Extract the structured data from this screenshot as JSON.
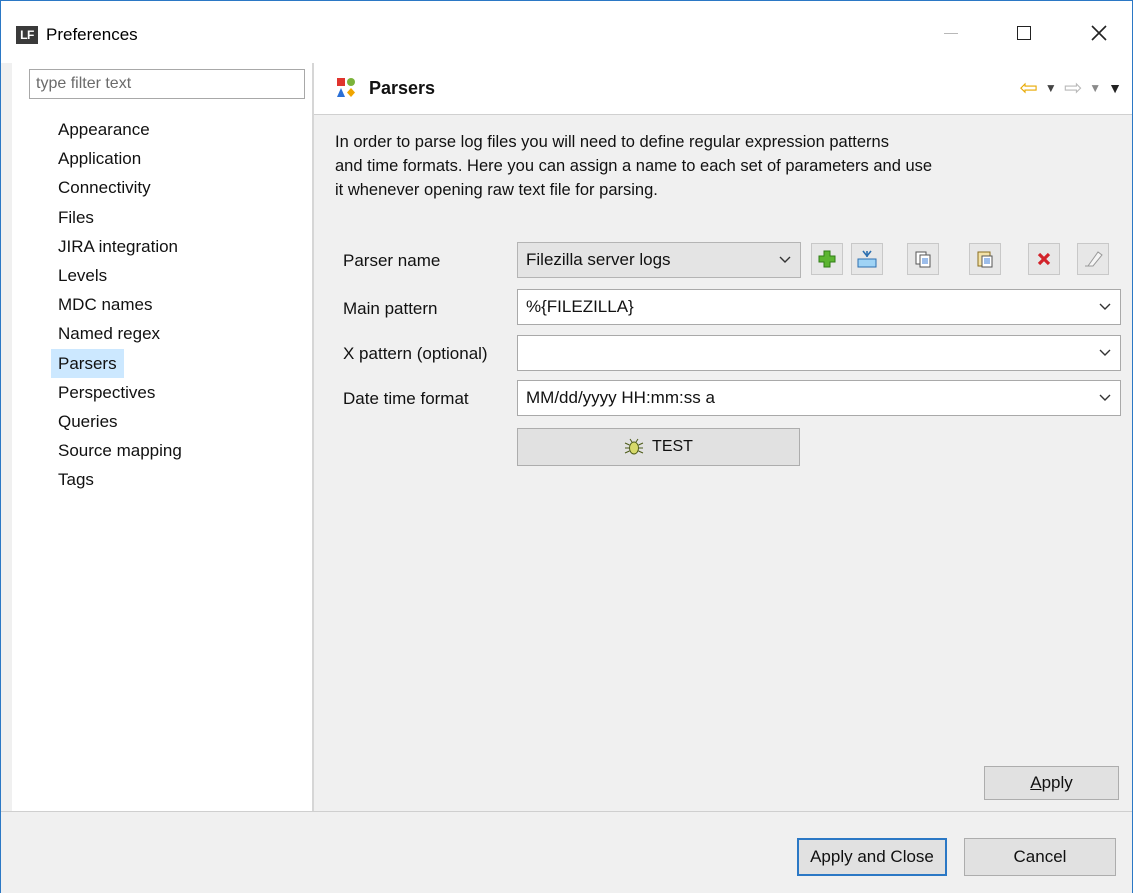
{
  "window": {
    "logo_text": "LF",
    "title": "Preferences"
  },
  "filter": {
    "placeholder": "type filter text"
  },
  "tree": {
    "items": [
      {
        "label": "Appearance"
      },
      {
        "label": "Application"
      },
      {
        "label": "Connectivity"
      },
      {
        "label": "Files"
      },
      {
        "label": "JIRA integration"
      },
      {
        "label": "Levels"
      },
      {
        "label": "MDC names"
      },
      {
        "label": "Named regex"
      },
      {
        "label": "Parsers"
      },
      {
        "label": "Perspectives"
      },
      {
        "label": "Queries"
      },
      {
        "label": "Source mapping"
      },
      {
        "label": "Tags"
      }
    ],
    "selected": "Parsers"
  },
  "page": {
    "title": "Parsers",
    "description_lines": [
      "In order to parse log files you will need to define regular expression patterns",
      "and time formats. Here you can assign a name to each set of parameters and use",
      "it whenever opening raw text file for parsing."
    ]
  },
  "form": {
    "parser_name_label": "Parser name",
    "parser_name_value": "Filezilla server logs",
    "main_pattern_label": "Main pattern",
    "main_pattern_value": "%{FILEZILLA}",
    "x_pattern_label": "X pattern (optional)",
    "x_pattern_value": "",
    "date_format_label": "Date time format",
    "date_format_value": "MM/dd/yyyy HH:mm:ss a",
    "test_label": "TEST"
  },
  "toolbar_icons": [
    "add-icon",
    "import-icon",
    "copy-icon",
    "paste-icon",
    "delete-icon",
    "clear-icon"
  ],
  "buttons": {
    "apply_prefix": "",
    "apply_mnemonic": "A",
    "apply_rest": "pply",
    "apply_and_close": "Apply and Close",
    "cancel": "Cancel"
  },
  "colors": {
    "accent": "#2b78c5",
    "selection": "#cce8ff",
    "nav_back": "#e8a800"
  }
}
